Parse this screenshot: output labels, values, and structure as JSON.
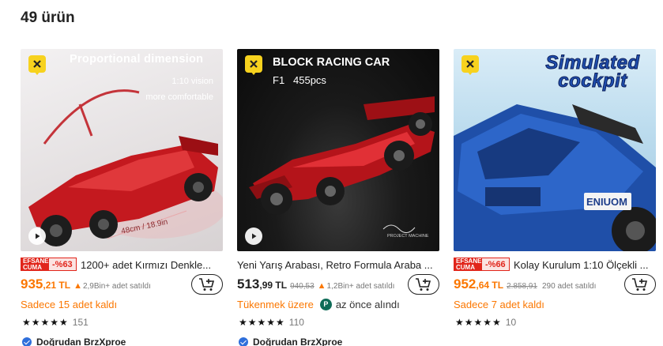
{
  "result_count": "49 ürün",
  "products": [
    {
      "image_heading": "Proportional dimension",
      "image_sub1": "1:10 vision",
      "image_sub2": "more comfortable",
      "image_dims": "48cm / 18.9in",
      "badge_top": "EFSANE",
      "badge_bottom": "CUMA",
      "discount": "-%63",
      "title": "1200+ adet Kırmızı Denkle...",
      "price_main": "935",
      "price_cents": ",21 TL",
      "old_price": "",
      "sold": "2,9Bin+ adet satıldı",
      "stock_text": "Sadece 15 adet kaldı",
      "recent_text": "",
      "stars": "★★★★★",
      "rating_count": "151",
      "shop": "Doğrudan BrzXproe"
    },
    {
      "image_heading": "BLOCK RACING CAR",
      "image_sub1": "F1   455pcs",
      "image_sub2": "PROJECT MACHINE",
      "image_dims": "",
      "badge_top": "",
      "badge_bottom": "",
      "discount": "",
      "title": "Yeni Yarış Arabası, Retro Formula Araba ...",
      "price_main": "513",
      "price_cents": ",99 TL",
      "old_price": "940,53",
      "sold": "1,2Bin+ adet satıldı",
      "stock_text": "Tükenmek üzere",
      "recent_text": "az önce alındı",
      "stars": "★★★★★",
      "rating_count": "110",
      "shop": "Doğrudan BrzXproe"
    },
    {
      "image_heading": "Simulated cockpit",
      "image_sub1": "ENIUOM",
      "image_sub2": "",
      "image_dims": "",
      "badge_top": "EFSANE",
      "badge_bottom": "CUMA",
      "discount": "-%66",
      "title": "Kolay Kurulum 1:10 Ölçekli ...",
      "price_main": "952",
      "price_cents": ",64 TL",
      "old_price": "2.858,91",
      "sold": "290 adet satıldı",
      "stock_text": "Sadece 7 adet kaldı",
      "recent_text": "",
      "stars": "★★★★★",
      "rating_count": "10",
      "shop": ""
    }
  ],
  "colors": {
    "accent_orange": "#fb7701",
    "sale_red": "#e1251b",
    "badge_yellow": "#f7d21e"
  },
  "icons": {
    "cart": "add-to-cart-icon",
    "play": "play-icon",
    "brand": "x-logo-icon",
    "flame": "flame-icon",
    "verified": "verified-icon"
  }
}
